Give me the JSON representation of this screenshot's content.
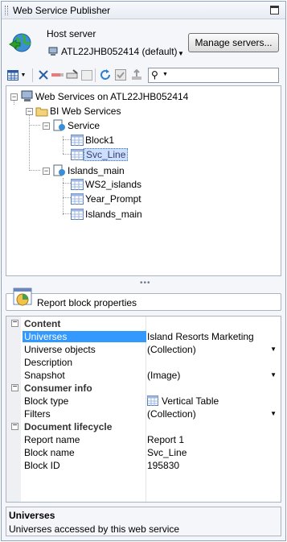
{
  "window": {
    "title": "Web Service Publisher"
  },
  "host": {
    "label": "Host server",
    "value": "ATL22JHB052414 (default)",
    "manage_label": "Manage servers..."
  },
  "toolbar": {
    "icons": [
      "table-view-icon",
      "dropdown-icon",
      "delete-icon",
      "edit-icon",
      "rename-icon",
      "refresh-icon",
      "publish-icon",
      "upload-icon",
      "search-icon"
    ],
    "search_value": ""
  },
  "tree": {
    "root": "Web Services on ATL22JHB052414",
    "folder": "BI Web Services",
    "service1": "Service",
    "service1_items": [
      "Block1",
      "Svc_Line"
    ],
    "service2": "Islands_main",
    "service2_items": [
      "WS2_islands",
      "Year_Prompt",
      "Islands_main"
    ],
    "selected": "Svc_Line"
  },
  "props_header": "Report block properties",
  "props": {
    "content_cat": "Content",
    "universes_k": "Universes",
    "universes_v": "Island Resorts Marketing",
    "universe_objects_k": "Universe objects",
    "universe_objects_v": "(Collection)",
    "description_k": "Description",
    "description_v": "",
    "snapshot_k": "Snapshot",
    "snapshot_v": "(Image)",
    "consumer_cat": "Consumer info",
    "block_type_k": "Block type",
    "block_type_v": "Vertical Table",
    "filters_k": "Filters",
    "filters_v": "(Collection)",
    "lifecycle_cat": "Document lifecycle",
    "report_name_k": "Report name",
    "report_name_v": "Report 1",
    "block_name_k": "Block name",
    "block_name_v": "Svc_Line",
    "block_id_k": "Block ID",
    "block_id_v": "195830"
  },
  "description": {
    "title": "Universes",
    "text": "Universes accessed by this web service"
  },
  "colors": {
    "selection": "#3399ff",
    "tree_selection": "#cce0fb",
    "border": "#8fa3bf"
  }
}
